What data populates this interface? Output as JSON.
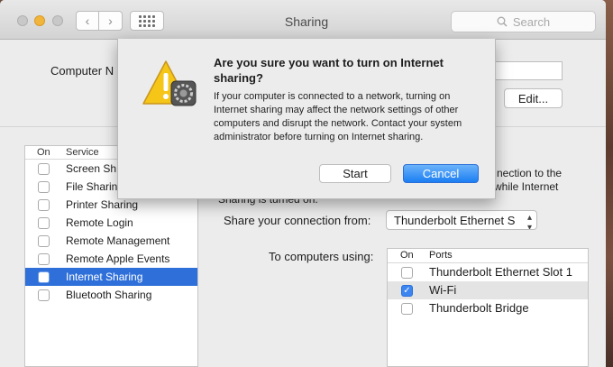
{
  "window": {
    "title": "Sharing"
  },
  "toolbar": {
    "search_placeholder": "Search"
  },
  "computer_name": {
    "label": "Computer N",
    "edit_label": "Edit..."
  },
  "services": {
    "col_on": "On",
    "col_service": "Service",
    "items": [
      {
        "label": "Screen Sh"
      },
      {
        "label": "File Sharin"
      },
      {
        "label": "Printer Sharing"
      },
      {
        "label": "Remote Login"
      },
      {
        "label": "Remote Management"
      },
      {
        "label": "Remote Apple Events"
      },
      {
        "label": "Internet Sharing",
        "selected": true
      },
      {
        "label": "Bluetooth Sharing"
      }
    ]
  },
  "detail": {
    "text_line1": "nection to the",
    "text_line2": "while Internet",
    "text_line3": "Sharing is turned on.",
    "share_from_label": "Share your connection from:",
    "share_from_value": "Thunderbolt Ethernet S",
    "to_computers_label": "To computers using:",
    "ports_col_on": "On",
    "ports_col_ports": "Ports",
    "ports": [
      {
        "label": "Thunderbolt Ethernet Slot 1",
        "checked": false
      },
      {
        "label": "Wi-Fi",
        "checked": true
      },
      {
        "label": "Thunderbolt Bridge",
        "checked": false
      }
    ]
  },
  "dialog": {
    "title": "Are you sure you want to turn on Internet sharing?",
    "body": "If your computer is connected to a network, turning on Internet sharing may affect the network settings of other computers and disrupt the network. Contact your system administrator before turning on Internet sharing.",
    "start_label": "Start",
    "cancel_label": "Cancel",
    "accent_color": "#1b7ef2"
  },
  "colors": {
    "selection": "#2e6fd9",
    "warning_yellow": "#f5c518"
  }
}
